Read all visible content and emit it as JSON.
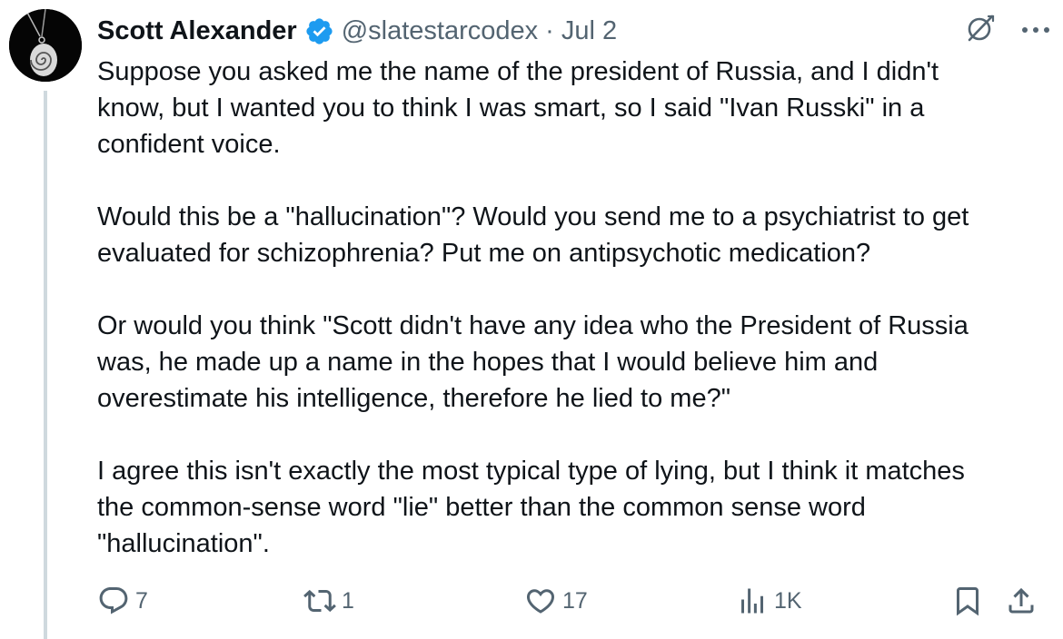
{
  "tweet": {
    "author_name": "Scott Alexander",
    "handle": "@slatestarcodex",
    "separator": "·",
    "date": "Jul 2",
    "paragraphs": [
      "Suppose you asked me the name of the president of Russia, and I didn't\nknow, but I wanted you to think I was smart, so I said \"Ivan Russki\" in a\nconfident voice.",
      "Would this be a \"hallucination\"? Would you send me to a psychiatrist to get\nevaluated for schizophrenia? Put me on antipsychotic medication?",
      "Or would you think \"Scott didn't have any idea who the President of Russia\nwas, he made up a name in the hopes that I would believe him and\noverestimate his intelligence, therefore he lied to me?\"",
      "I agree this isn't exactly the most typical type of lying, but I think it matches\nthe common-sense word \"lie\" better than the common sense word\n\"hallucination\"."
    ],
    "metrics": {
      "replies": "7",
      "reposts": "1",
      "likes": "17",
      "views": "1K"
    },
    "icons": {
      "verified": "verified-badge-icon",
      "grok": "grok-icon",
      "more": "more-icon",
      "reply": "reply-icon",
      "repost": "repost-icon",
      "like": "like-icon",
      "views": "views-icon",
      "bookmark": "bookmark-icon",
      "share": "share-icon"
    },
    "colors": {
      "text": "#0f1419",
      "secondary": "#536471",
      "verified": "#1d9bf0",
      "thread_line": "#cfd9de"
    }
  }
}
